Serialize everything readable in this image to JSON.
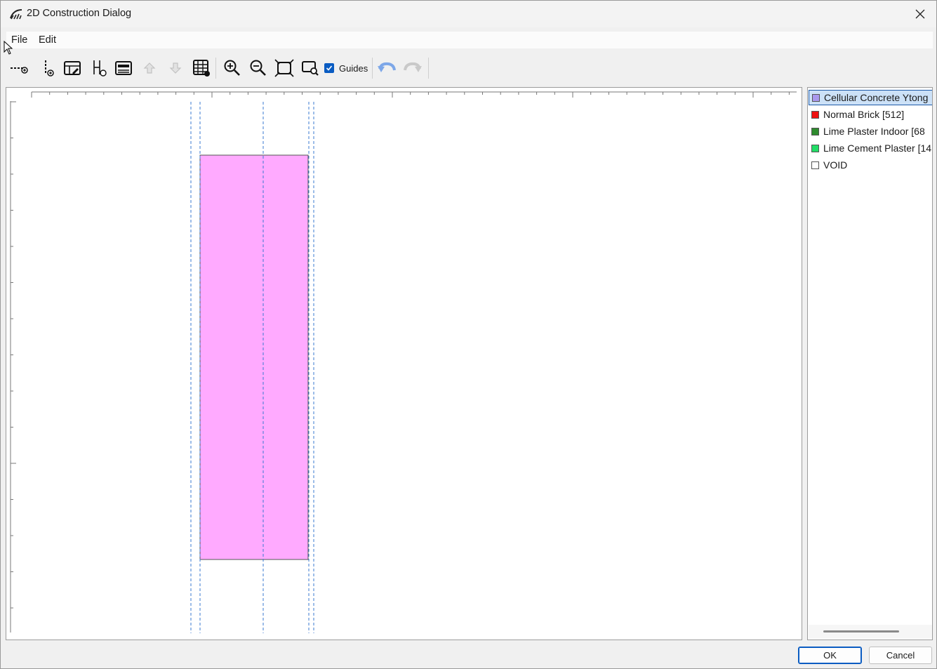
{
  "window": {
    "title": "2D Construction Dialog"
  },
  "menu": {
    "file": "File",
    "edit": "Edit"
  },
  "toolbar": {
    "guides_label": "Guides",
    "guides_checked": true,
    "icons": [
      "add-horizontal-line-icon",
      "add-vertical-line-icon",
      "edit-table-icon",
      "split-column-icon",
      "edit-row-icon",
      "move-up-icon",
      "move-down-icon",
      "grid-table-icon",
      "zoom-in-icon",
      "zoom-out-icon",
      "zoom-fit-icon",
      "zoom-select-icon",
      "undo-icon",
      "redo-icon"
    ]
  },
  "canvas": {
    "material_fill": "#ffaaff",
    "guide_color": "#3a7ad0"
  },
  "legend": {
    "items": [
      {
        "label": "Cellular Concrete Ytong",
        "color": "#aa99ee",
        "selected": true
      },
      {
        "label": "Normal Brick [512]",
        "color": "#ee1111",
        "selected": false
      },
      {
        "label": "Lime Plaster Indoor [68",
        "color": "#2e8b2e",
        "selected": false
      },
      {
        "label": "Lime Cement Plaster [14",
        "color": "#22dd66",
        "selected": false
      },
      {
        "label": "VOID",
        "color": "#ffffff",
        "selected": false
      }
    ]
  },
  "buttons": {
    "ok": "OK",
    "cancel": "Cancel"
  }
}
